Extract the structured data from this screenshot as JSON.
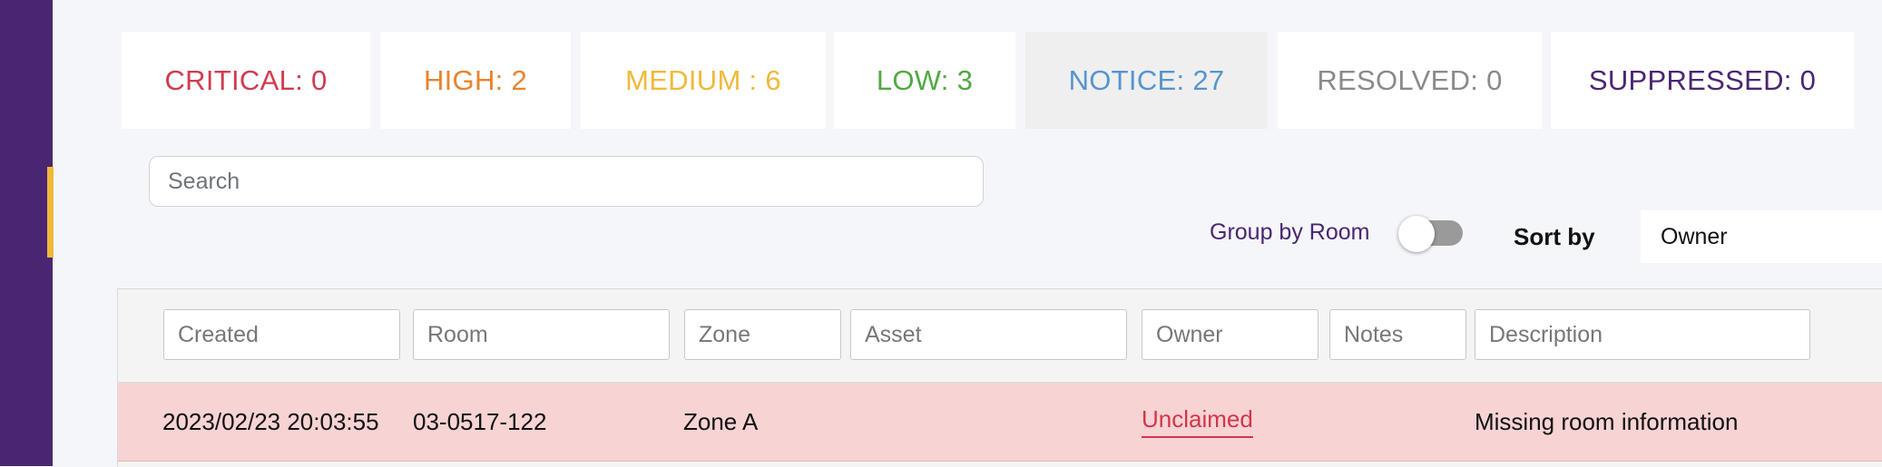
{
  "severity": {
    "critical": {
      "label": "CRITICAL: 0",
      "color": "#d13b4e"
    },
    "high": {
      "label": "HIGH: 2",
      "color": "#e8842f"
    },
    "medium": {
      "label": "MEDIUM : 6",
      "color": "#f0b93a"
    },
    "low": {
      "label": "LOW: 3",
      "color": "#52a843"
    },
    "notice": {
      "label": "NOTICE: 27",
      "color": "#5595ce",
      "active": true
    },
    "resolved": {
      "label": "RESOLVED: 0",
      "color": "#8a8a8a"
    },
    "suppressed": {
      "label": "SUPPRESSED: 0",
      "color": "#4a2672"
    }
  },
  "search": {
    "placeholder": "Search"
  },
  "group_by": {
    "label": "Group by Room",
    "enabled": false
  },
  "sort": {
    "label": "Sort by",
    "value": "Owner"
  },
  "filters": {
    "created": "Created",
    "room": "Room",
    "zone": "Zone",
    "asset": "Asset",
    "owner": "Owner",
    "notes": "Notes",
    "description": "Description"
  },
  "rows": [
    {
      "created": "2023/02/23 20:03:55",
      "room": "03-0517-122",
      "zone": "Zone A",
      "asset": "",
      "owner": "Unclaimed",
      "notes": "",
      "description": "Missing room information"
    }
  ],
  "colors": {
    "sidebar": "#4a2672",
    "accent": "#f0b93a",
    "row_highlight": "#f7d3d4"
  }
}
